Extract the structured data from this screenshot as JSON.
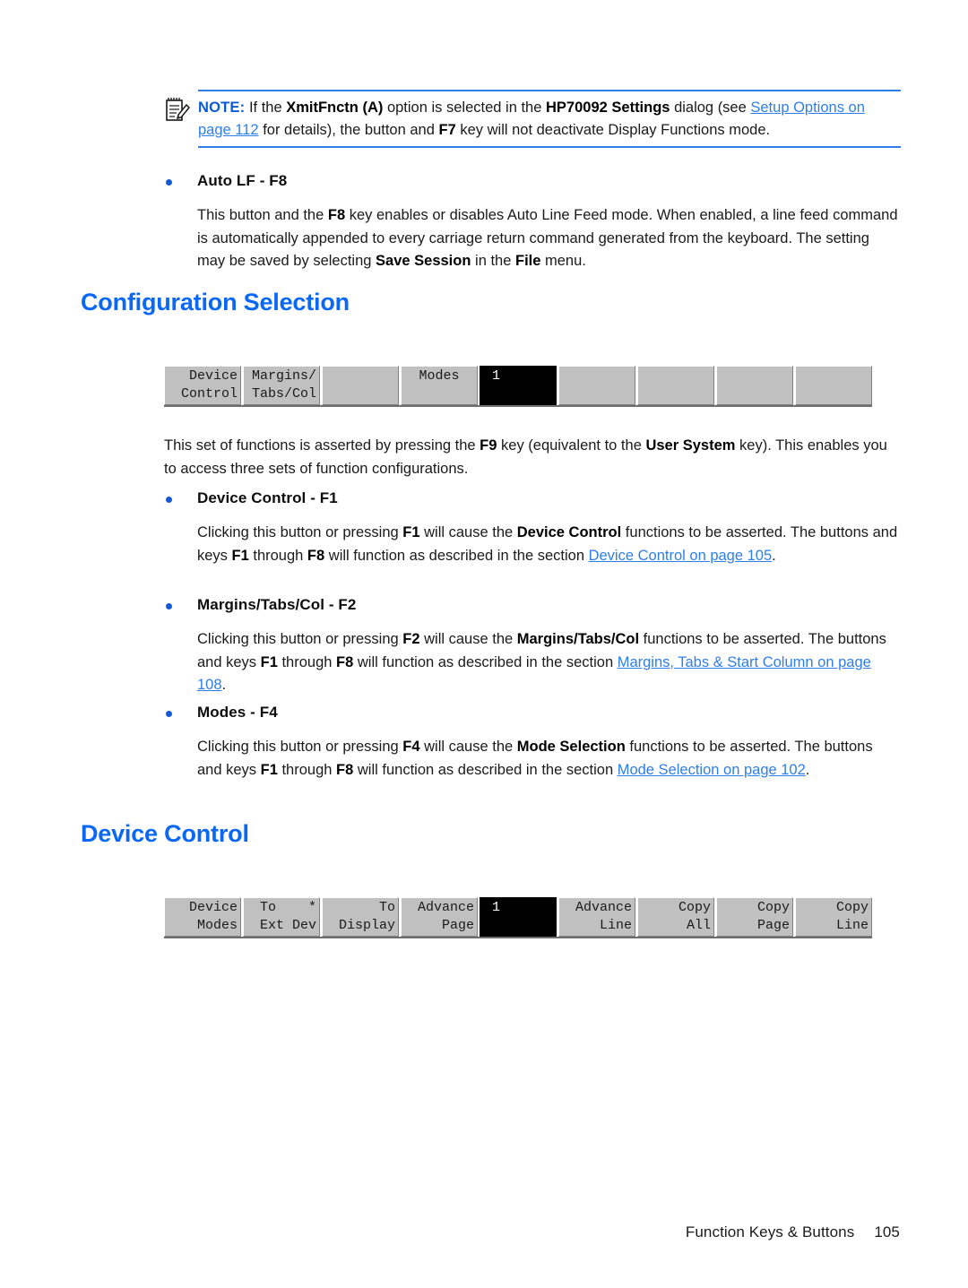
{
  "note": {
    "icon": "note-pad-pencil-icon",
    "label": "NOTE:",
    "text_1": "If the ",
    "bold_1": "XmitFnctn (A)",
    "text_2": " option is selected in the ",
    "bold_2": "HP70092 Settings",
    "text_3": " dialog (see ",
    "link_1": "Setup Options on page 112",
    "text_4": " for details), the button and ",
    "bold_3": "F7",
    "text_5": " key will not deactivate Display Functions mode."
  },
  "auto_lf": {
    "heading": "Auto LF - F8",
    "text_1": "This button and the ",
    "bold_1": "F8",
    "text_2": " key enables or disables Auto Line Feed mode. When enabled, a line feed command is automatically appended to every carriage return command generated from the keyboard. The setting may be saved by selecting ",
    "bold_2": "Save Session",
    "text_3": " in the ",
    "bold_3": "File",
    "text_4": " menu."
  },
  "config_selection": {
    "heading": "Configuration Selection",
    "intro_1": "This set of functions is asserted by pressing the ",
    "intro_bold_1": "F9",
    "intro_2": " key (equivalent to the ",
    "intro_bold_2": "User System",
    "intro_3": " key). This enables you to access three sets of function configurations."
  },
  "config_fkeybar": {
    "name": "configuration-selection-function-key-bar",
    "keys": [
      {
        "row1": "Device",
        "row2": "Control",
        "dark": false,
        "align": "right"
      },
      {
        "row1": "Margins/",
        "row2": "Tabs/Col",
        "dark": false,
        "align": "right"
      },
      {
        "row1": "",
        "row2": "",
        "dark": false,
        "align": "right"
      },
      {
        "row1": "Modes",
        "row2": "",
        "dark": false,
        "align": "center"
      },
      {
        "row1": "1      1",
        "row2": "",
        "dark": true,
        "align": "center"
      },
      {
        "row1": "",
        "row2": "",
        "dark": false,
        "align": "right"
      },
      {
        "row1": "",
        "row2": "",
        "dark": false,
        "align": "right"
      },
      {
        "row1": "",
        "row2": "",
        "dark": false,
        "align": "right"
      },
      {
        "row1": "",
        "row2": "",
        "dark": false,
        "align": "right"
      }
    ]
  },
  "device_control_f1": {
    "heading": "Device Control - F1",
    "text_1": "Clicking this button or pressing ",
    "bold_1": "F1",
    "text_2": " will cause the ",
    "bold_2": "Device Control",
    "text_3": " functions to be asserted. The buttons and keys ",
    "bold_3": "F1",
    "text_4": " through ",
    "bold_4": "F8",
    "text_5": " will function as described in the section ",
    "link_1": "Device Control on page 105",
    "text_6": "."
  },
  "margins_tabs_col_f2": {
    "heading": "Margins/Tabs/Col - F2",
    "text_1": "Clicking this button or pressing ",
    "bold_1": "F2",
    "text_2": " will cause the ",
    "bold_2": "Margins/Tabs/Col",
    "text_3": " functions to be asserted. The buttons and keys ",
    "bold_3": "F1",
    "text_4": " through ",
    "bold_4": "F8",
    "text_5": " will function as described in the section ",
    "link_1": "Margins, Tabs & Start Column on page 108",
    "text_6": "."
  },
  "modes_f4": {
    "heading": "Modes - F4",
    "text_1": "Clicking this button or pressing ",
    "bold_1": "F4",
    "text_2": " will cause the ",
    "bold_2": "Mode Selection",
    "text_3": " functions to be asserted. The buttons and keys ",
    "bold_3": "F1",
    "text_4": " through ",
    "bold_4": "F8",
    "text_5": " will function as described in the section ",
    "link_1": "Mode Selection on page 102",
    "text_6": "."
  },
  "device_control": {
    "heading": "Device Control"
  },
  "device_control_fkeybar": {
    "name": "device-control-function-key-bar",
    "keys": [
      {
        "row1": "Device",
        "row2": "Modes",
        "dark": false,
        "align": "right"
      },
      {
        "row1": "To    *",
        "row2": "Ext Dev",
        "dark": false,
        "align": "right"
      },
      {
        "row1": "To",
        "row2": "Display",
        "dark": false,
        "align": "right"
      },
      {
        "row1": "Advance",
        "row2": "Page",
        "dark": false,
        "align": "right"
      },
      {
        "row1": "1      1",
        "row2": "",
        "dark": true,
        "align": "center"
      },
      {
        "row1": "Advance",
        "row2": "Line",
        "dark": false,
        "align": "right"
      },
      {
        "row1": "Copy",
        "row2": "All",
        "dark": false,
        "align": "right"
      },
      {
        "row1": "Copy",
        "row2": "Page",
        "dark": false,
        "align": "right"
      },
      {
        "row1": "Copy",
        "row2": "Line",
        "dark": false,
        "align": "right"
      }
    ]
  },
  "footer": {
    "label": "Function Keys & Buttons",
    "page_number": "105"
  },
  "colors": {
    "heading_blue": "#0a68f5",
    "link_blue": "#2f7fe8",
    "note_label_blue": "#0a5bd3",
    "bullet_blue": "#1559d6",
    "key_gray": "#c0c0c0",
    "key_dark": "#000000"
  }
}
